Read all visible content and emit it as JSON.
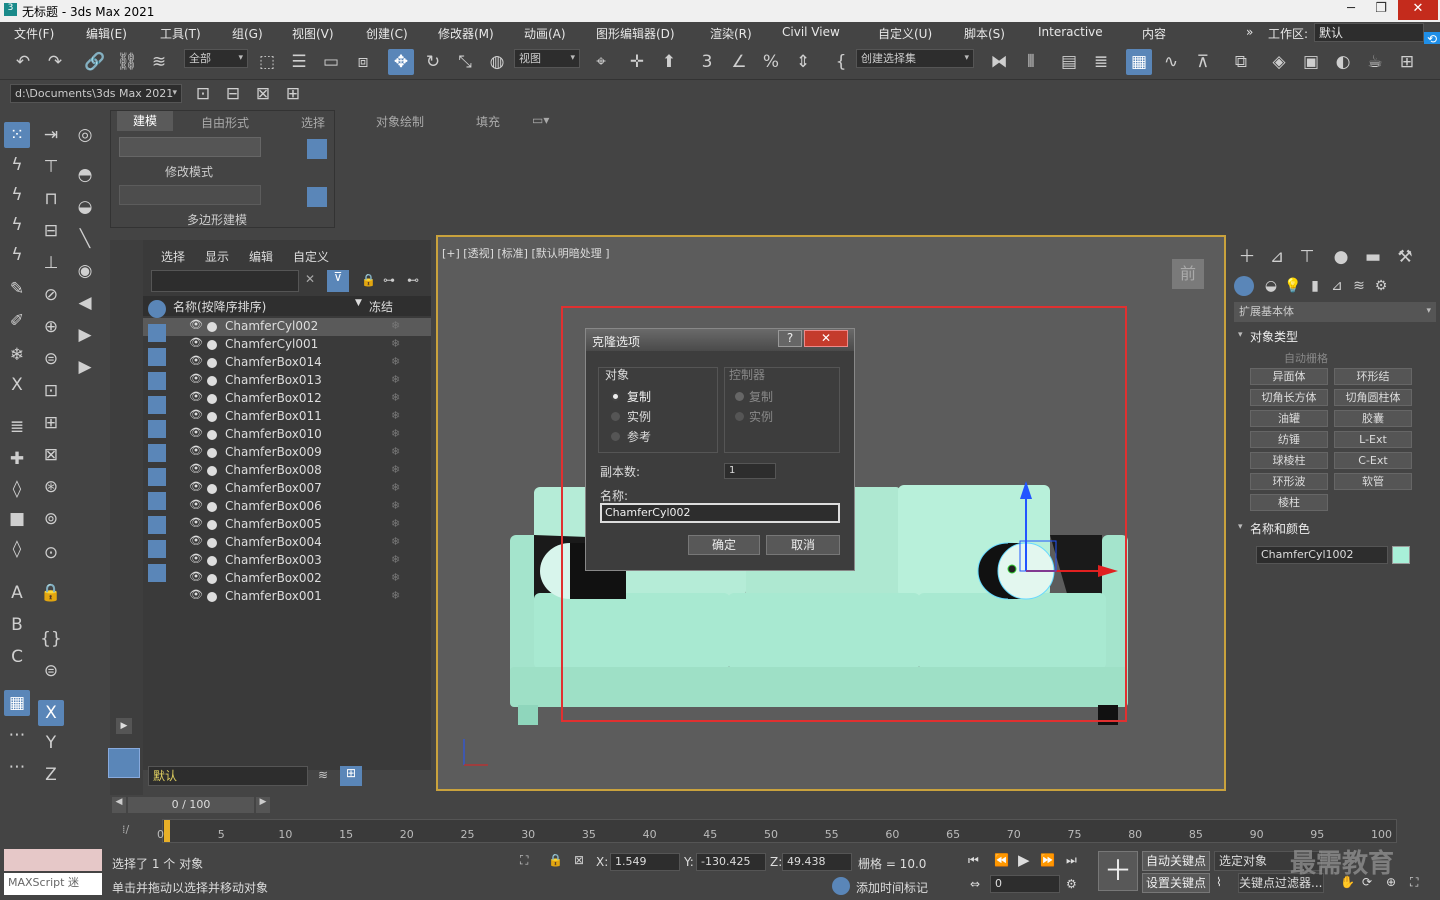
{
  "window": {
    "title": "无标题 - 3ds Max 2021"
  },
  "menu": [
    "文件(F)",
    "编辑(E)",
    "工具(T)",
    "组(G)",
    "视图(V)",
    "创建(C)",
    "修改器(M)",
    "动画(A)",
    "图形编辑器(D)",
    "渲染(R)",
    "Civil View",
    "自定义(U)",
    "脚本(S)",
    "Interactive",
    "内容"
  ],
  "workspace": {
    "label": "工作区:",
    "value": "默认"
  },
  "toolbar": {
    "filter": "全部",
    "refcoord": "视图",
    "selset": "创建选择集",
    "path": "d:\\Documents\\3ds Max 2021"
  },
  "ribbon": {
    "tabs": [
      "建模",
      "自由形式",
      "选择",
      "对象绘制",
      "填充"
    ],
    "mode_label": "修改模式",
    "poly_label": "多边形建模"
  },
  "scene": {
    "tabs": [
      "选择",
      "显示",
      "编辑",
      "自定义"
    ],
    "col_name": "名称(按降序排序)",
    "col_freeze": "冻结",
    "items": [
      "ChamferCyl002",
      "ChamferCyl001",
      "ChamferBox014",
      "ChamferBox013",
      "ChamferBox012",
      "ChamferBox011",
      "ChamferBox010",
      "ChamferBox009",
      "ChamferBox008",
      "ChamferBox007",
      "ChamferBox006",
      "ChamferBox005",
      "ChamferBox004",
      "ChamferBox003",
      "ChamferBox002",
      "ChamferBox001"
    ],
    "layer": "默认"
  },
  "viewport": {
    "label": "[+] [透视] [标准] [默认明暗处理 ]",
    "cube": "前"
  },
  "dialog": {
    "title": "克隆选项",
    "help": "?",
    "close": "✕",
    "object_group": "对象",
    "controller_group": "控制器",
    "opt_copy": "复制",
    "opt_instance": "实例",
    "opt_ref": "参考",
    "ctrl_copy": "复制",
    "ctrl_instance": "实例",
    "count_label": "副本数:",
    "count_value": "1",
    "name_label": "名称:",
    "name_value": "ChamferCyl002",
    "ok": "确定",
    "cancel": "取消"
  },
  "cmd": {
    "category": "扩展基本体",
    "object_type": "对象类型",
    "autogrid": "自动栅格",
    "buttons": [
      "异面体",
      "环形结",
      "切角长方体",
      "切角圆柱体",
      "油罐",
      "胶囊",
      "纺锤",
      "L-Ext",
      "球棱柱",
      "C-Ext",
      "环形波",
      "软管",
      "棱柱"
    ],
    "name_color": "名称和颜色",
    "name_value": "ChamferCyl1002",
    "swatch": "#a8f0d8"
  },
  "timeline": {
    "frame": "0 / 100",
    "ticks": [
      "0",
      "5",
      "10",
      "15",
      "20",
      "25",
      "30",
      "35",
      "40",
      "45",
      "50",
      "55",
      "60",
      "65",
      "70",
      "75",
      "80",
      "85",
      "90",
      "95",
      "100"
    ]
  },
  "status": {
    "selected": "选择了 1 个 对象",
    "hint": "单击并拖动以选择并移动对象",
    "maxscript": "MAXScript 迷",
    "x_label": "X:",
    "x": "1.549",
    "y_label": "Y:",
    "y": "-130.425",
    "z_label": "Z:",
    "z": "49.438",
    "grid": "栅格 = 10.0",
    "addtime": "添加时间标记",
    "autokey": "自动关键点",
    "setkey": "设置关键点",
    "selobj": "选定对象",
    "keyfilter": "关键点过滤器...",
    "frame_field": "0",
    "watermark": "最需教育"
  }
}
